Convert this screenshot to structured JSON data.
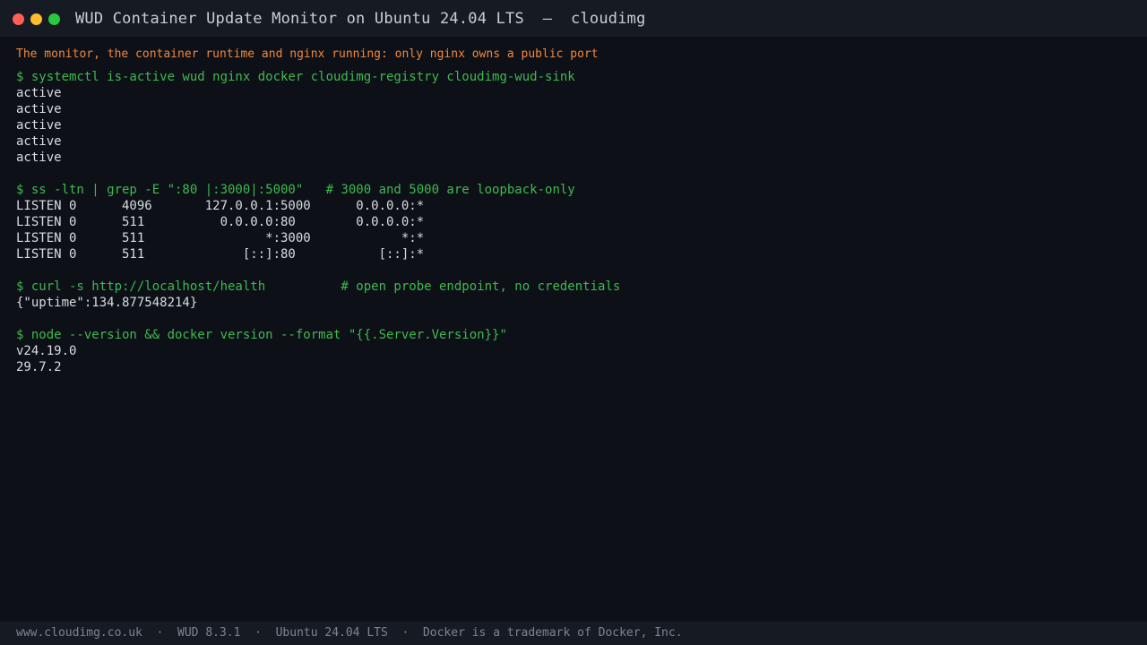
{
  "window": {
    "title": "WUD Container Update Monitor on Ubuntu 24.04 LTS  –  cloudimg",
    "controls": [
      "close-icon",
      "minimize-icon",
      "maximize-icon"
    ]
  },
  "terminal": {
    "note": "The monitor, the container runtime and nginx running: only nginx owns a public port",
    "blocks": [
      {
        "command": "$ systemctl is-active wud nginx docker cloudimg-registry cloudimg-wud-sink",
        "output": [
          "active",
          "active",
          "active",
          "active",
          "active"
        ]
      },
      {
        "command": "$ ss -ltn | grep -E \":80 |:3000|:5000\"   # 3000 and 5000 are loopback-only",
        "output": [
          "LISTEN 0      4096       127.0.0.1:5000      0.0.0.0:*",
          "LISTEN 0      511          0.0.0.0:80        0.0.0.0:*",
          "LISTEN 0      511                *:3000            *:*",
          "LISTEN 0      511             [::]:80           [::]:*"
        ]
      },
      {
        "command": "$ curl -s http://localhost/health          # open probe endpoint, no credentials",
        "output": [
          "{\"uptime\":134.877548214}"
        ]
      },
      {
        "command": "$ node --version && docker version --format \"{{.Server.Version}}\"",
        "output": [
          "v24.19.0",
          "29.7.2"
        ]
      }
    ]
  },
  "footer": {
    "text": "www.cloudimg.co.uk  ·  WUD 8.3.1  ·  Ubuntu 24.04 LTS  ·  Docker is a trademark of Docker, Inc."
  },
  "colors": {
    "background": "#0d1017",
    "titlebar": "#161a22",
    "command": "#3fb950",
    "output": "#d7dce3",
    "note": "#f0883e",
    "footer_text": "#7d8590"
  }
}
